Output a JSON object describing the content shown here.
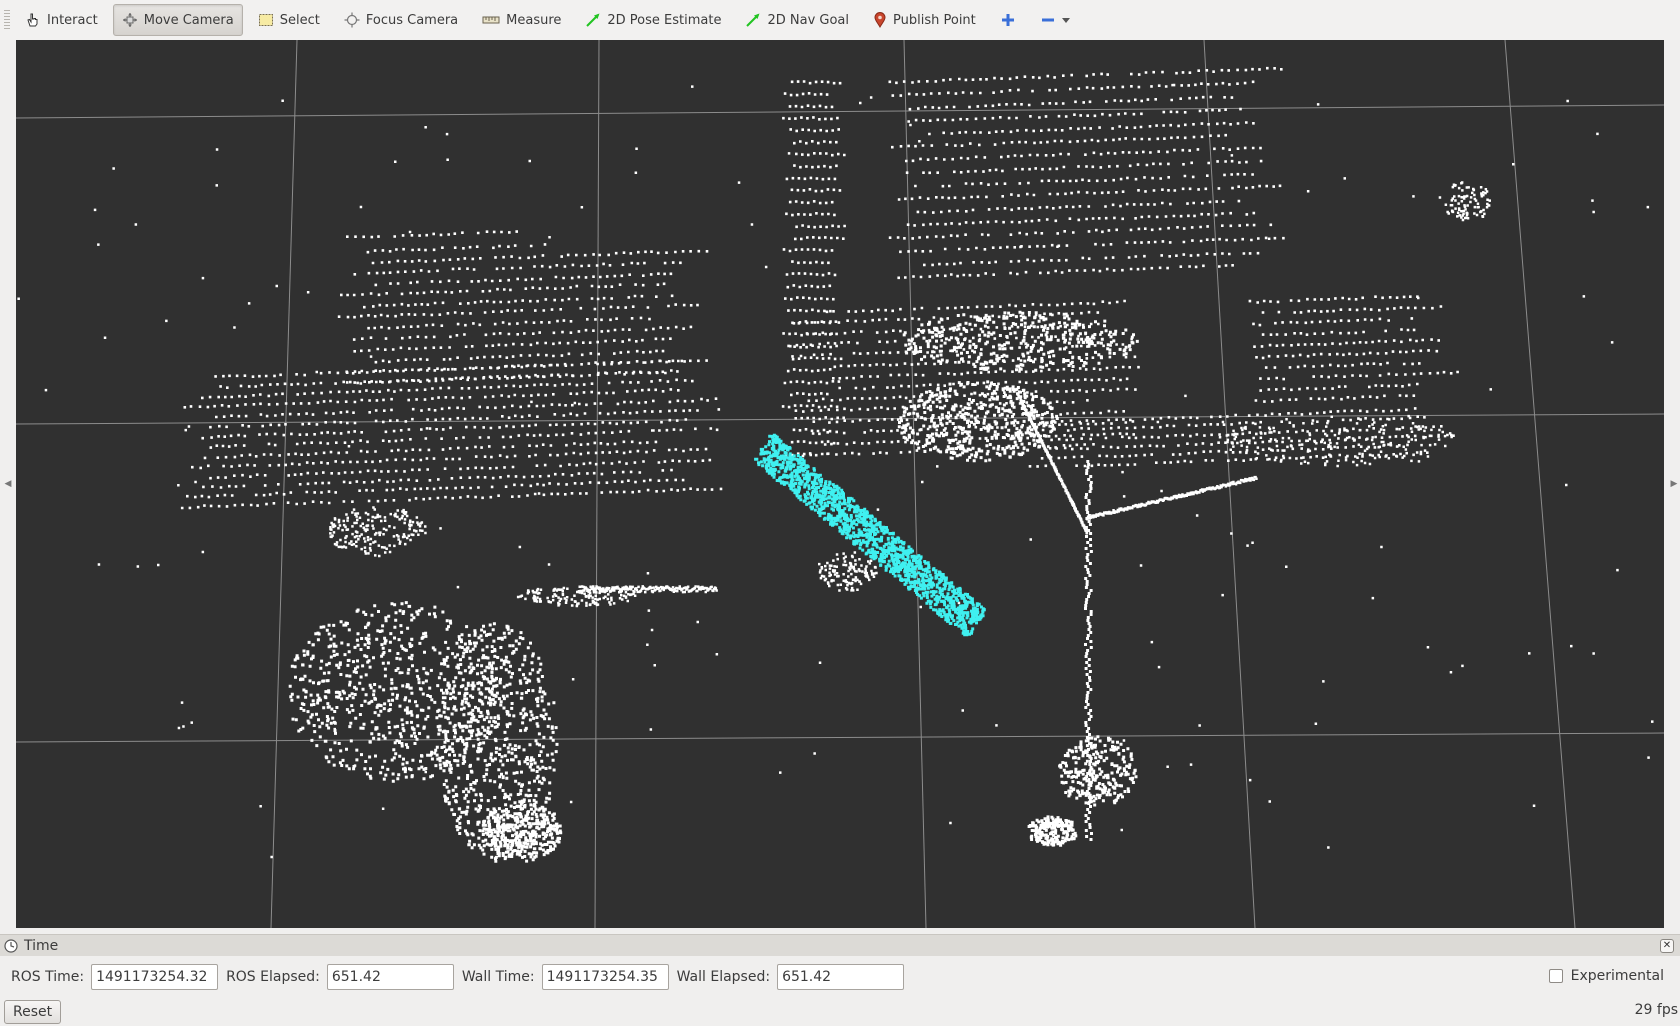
{
  "toolbar": {
    "tools": [
      {
        "label": "Interact",
        "icon": "hand-pointer-icon",
        "active": false
      },
      {
        "label": "Move Camera",
        "icon": "move-camera-icon",
        "active": true
      },
      {
        "label": "Select",
        "icon": "select-box-icon",
        "active": false
      },
      {
        "label": "Focus Camera",
        "icon": "focus-camera-icon",
        "active": false
      },
      {
        "label": "Measure",
        "icon": "ruler-icon",
        "active": false
      },
      {
        "label": "2D Pose Estimate",
        "icon": "green-arrow-icon",
        "active": false
      },
      {
        "label": "2D Nav Goal",
        "icon": "green-arrow-icon",
        "active": false
      },
      {
        "label": "Publish Point",
        "icon": "map-pin-icon",
        "active": false
      }
    ],
    "add_tool_icon": "plus-icon",
    "remove_tool_icon": "minus-icon"
  },
  "viewport": {
    "background": "#303030",
    "grid_color": "#9a9a9a",
    "point_color": "#ffffff",
    "highlight_color": "#3ff0f0"
  },
  "time_panel": {
    "title": "Time",
    "ros_time_label": "ROS Time:",
    "ros_time": "1491173254.32",
    "ros_elapsed_label": "ROS Elapsed:",
    "ros_elapsed": "651.42",
    "wall_time_label": "Wall Time:",
    "wall_time": "1491173254.35",
    "wall_elapsed_label": "Wall Elapsed:",
    "wall_elapsed": "651.42",
    "experimental_label": "Experimental",
    "experimental_checked": false
  },
  "status": {
    "reset_label": "Reset",
    "fps": "29 fps"
  }
}
